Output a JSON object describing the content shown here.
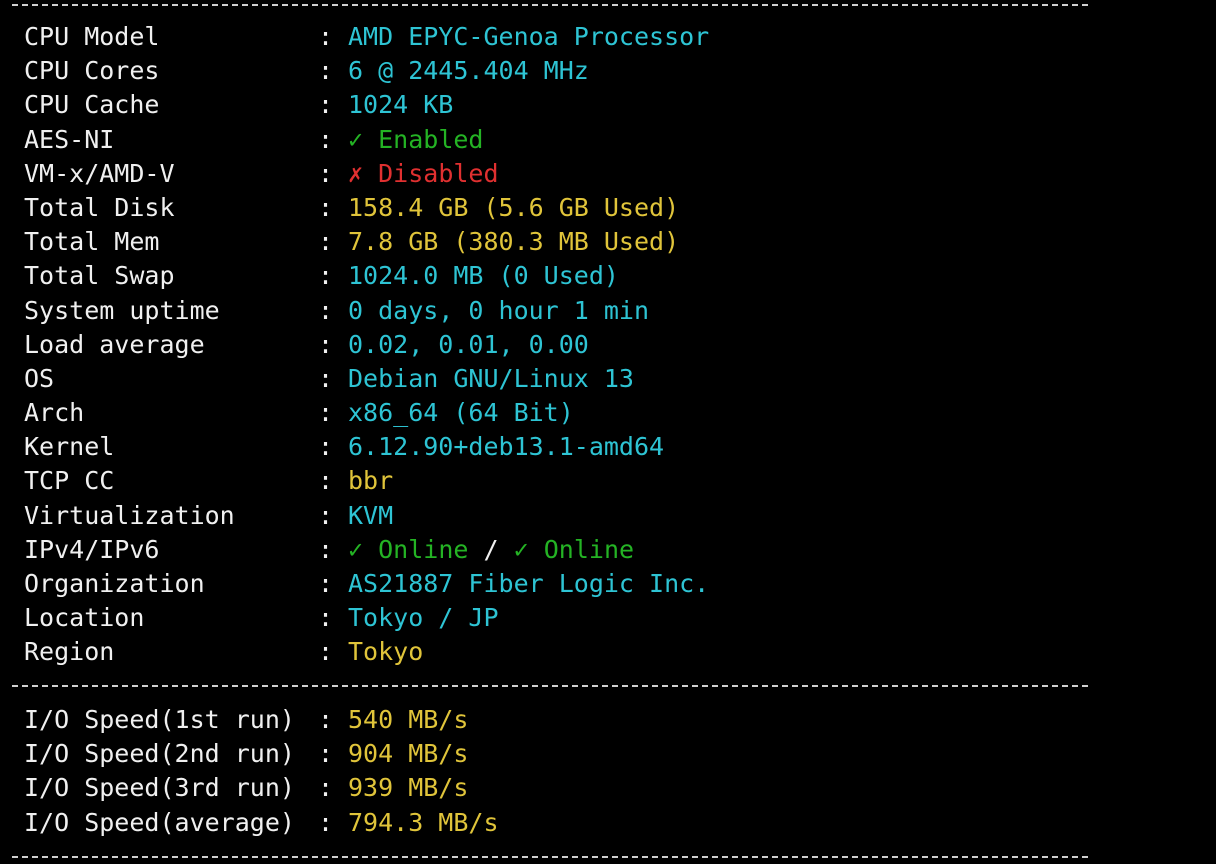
{
  "colors": {
    "background": "#000000",
    "label": "#f0f0f0",
    "cyan": "#2ec4d4",
    "yellow": "#e0c43a",
    "green": "#24b324",
    "red": "#e03030"
  },
  "separator": "-",
  "system_info": [
    {
      "label": "CPU Model",
      "value": "AMD EPYC-Genoa Processor",
      "color": "cyan"
    },
    {
      "label": "CPU Cores",
      "value": "6 @ 2445.404 MHz",
      "color": "cyan"
    },
    {
      "label": "CPU Cache",
      "value": "1024 KB",
      "color": "cyan"
    },
    {
      "label": "AES-NI",
      "mark": "✓",
      "value": "Enabled",
      "color": "green"
    },
    {
      "label": "VM-x/AMD-V",
      "mark": "✗",
      "value": "Disabled",
      "color": "red"
    },
    {
      "label": "Total Disk",
      "value": "158.4 GB (5.6 GB Used)",
      "color": "yellow"
    },
    {
      "label": "Total Mem",
      "value": "7.8 GB (380.3 MB Used)",
      "color": "yellow"
    },
    {
      "label": "Total Swap",
      "value": "1024.0 MB (0 Used)",
      "color": "cyan"
    },
    {
      "label": "System uptime",
      "value": "0 days, 0 hour 1 min",
      "color": "cyan"
    },
    {
      "label": "Load average",
      "value": "0.02, 0.01, 0.00",
      "color": "cyan"
    },
    {
      "label": "OS",
      "value": "Debian GNU/Linux 13",
      "color": "cyan"
    },
    {
      "label": "Arch",
      "value": "x86_64 (64 Bit)",
      "color": "cyan"
    },
    {
      "label": "Kernel",
      "value": "6.12.90+deb13.1-amd64",
      "color": "cyan"
    },
    {
      "label": "TCP CC",
      "value": "bbr",
      "color": "yellow"
    },
    {
      "label": "Virtualization",
      "value": "KVM",
      "color": "cyan"
    }
  ],
  "ip_row": {
    "label": "IPv4/IPv6",
    "ipv4_mark": "✓",
    "ipv4_status": "Online",
    "divider": "/",
    "ipv6_mark": "✓",
    "ipv6_status": "Online"
  },
  "location_info": [
    {
      "label": "Organization",
      "value": "AS21887 Fiber Logic Inc.",
      "color": "cyan"
    },
    {
      "label": "Location",
      "value": "Tokyo / JP",
      "color": "cyan"
    },
    {
      "label": "Region",
      "value": "Tokyo",
      "color": "yellow"
    }
  ],
  "io_speed": [
    {
      "label": "I/O Speed(1st run)",
      "value": "540 MB/s"
    },
    {
      "label": "I/O Speed(2nd run)",
      "value": "904 MB/s"
    },
    {
      "label": "I/O Speed(3rd run)",
      "value": "939 MB/s"
    },
    {
      "label": "I/O Speed(average)",
      "value": "794.3 MB/s"
    }
  ],
  "colon": ":"
}
